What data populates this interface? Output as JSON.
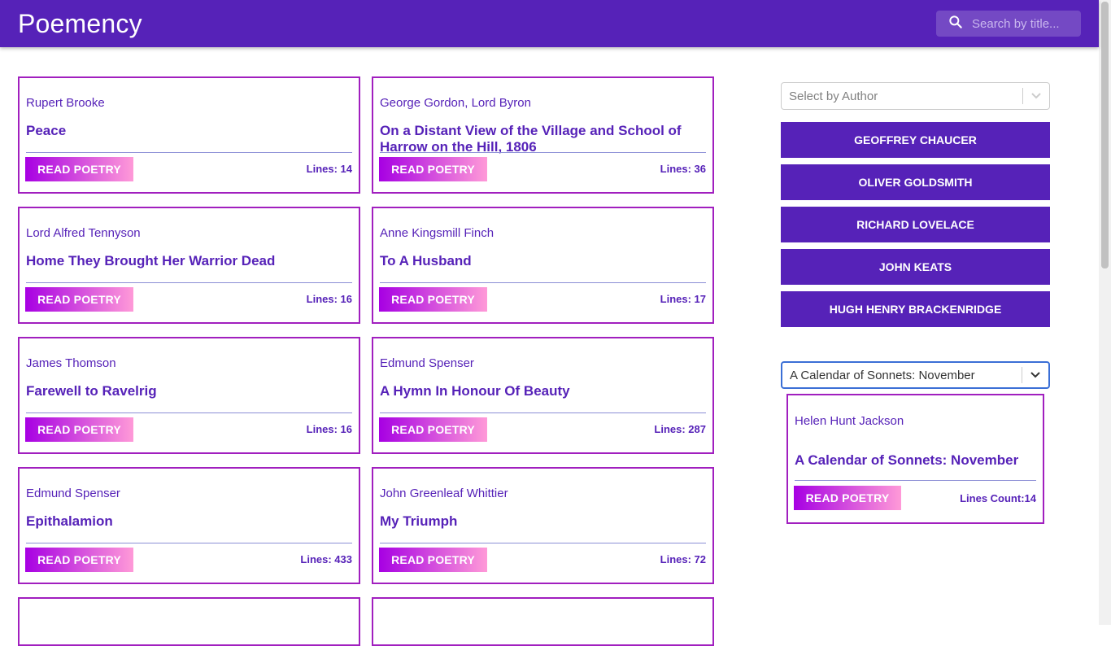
{
  "app": {
    "title": "Poemency",
    "search_placeholder": "Search by title..."
  },
  "colors": {
    "primary": "#5622b8",
    "card_border": "#a11fbf",
    "button_gradient_start": "#a700e3",
    "button_gradient_end": "#ff9ad8",
    "select_focus": "#3b6fd6"
  },
  "poems": [
    {
      "author": "Rupert Brooke",
      "title": "Peace",
      "button": "READ POETRY",
      "lines": "Lines: 14"
    },
    {
      "author": "George Gordon, Lord Byron",
      "title": "On a Distant View of the Village and School of Harrow on the Hill, 1806",
      "button": "READ POETRY",
      "lines": "Lines: 36"
    },
    {
      "author": "Lord Alfred Tennyson",
      "title": "Home They Brought Her Warrior Dead",
      "button": "READ POETRY",
      "lines": "Lines: 16"
    },
    {
      "author": "Anne Kingsmill Finch",
      "title": "To A Husband",
      "button": "READ POETRY",
      "lines": "Lines: 17"
    },
    {
      "author": "James Thomson",
      "title": "Farewell to Ravelrig",
      "button": "READ POETRY",
      "lines": "Lines: 16"
    },
    {
      "author": "Edmund Spenser",
      "title": "A Hymn In Honour Of Beauty",
      "button": "READ POETRY",
      "lines": "Lines: 287"
    },
    {
      "author": "Edmund Spenser",
      "title": "Epithalamion",
      "button": "READ POETRY",
      "lines": "Lines: 433"
    },
    {
      "author": "John Greenleaf Whittier",
      "title": "My Triumph",
      "button": "READ POETRY",
      "lines": "Lines: 72"
    }
  ],
  "sidebar": {
    "author_select_placeholder": "Select by Author",
    "authors": [
      "GEOFFREY CHAUCER",
      "OLIVER GOLDSMITH",
      "RICHARD LOVELACE",
      "JOHN KEATS",
      "HUGH HENRY BRACKENRIDGE"
    ],
    "poem_select_value": "A Calendar of Sonnets: November",
    "featured": {
      "author": "Helen Hunt Jackson",
      "title": "A Calendar of Sonnets: November",
      "button": "READ POETRY",
      "lines": "Lines Count:14"
    }
  }
}
